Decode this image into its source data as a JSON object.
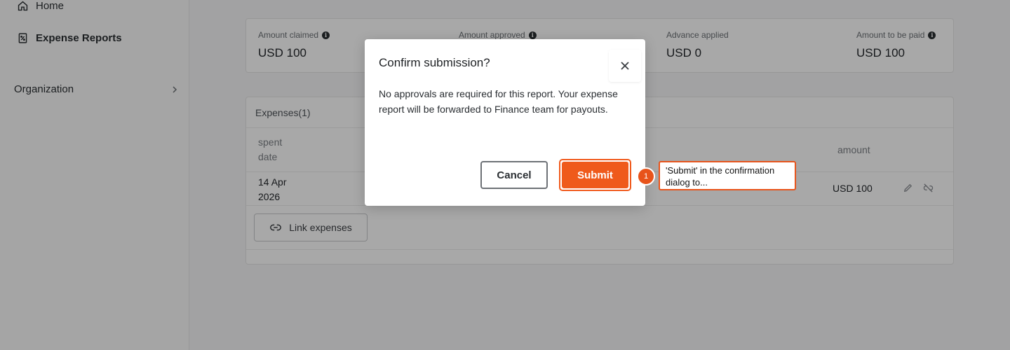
{
  "sidebar": {
    "items": [
      {
        "label": "Home",
        "icon": "home-icon"
      },
      {
        "label": "Expense Reports",
        "icon": "receipt-icon"
      }
    ],
    "organization": {
      "label": "Organization",
      "icon": "chevron-right-icon"
    }
  },
  "summary": {
    "amount_claimed": {
      "label": "Amount claimed",
      "value": "USD 100"
    },
    "amount_approved": {
      "label": "Amount approved"
    },
    "advance_applied": {
      "label": "Advance applied",
      "value": "USD 0"
    },
    "amount_to_be_paid": {
      "label": "Amount to be paid",
      "value": "USD 100"
    }
  },
  "expenses": {
    "title": "Expenses(1)",
    "columns": {
      "spent_date_line1": "spent",
      "spent_date_line2": "date",
      "amount": "amount"
    },
    "rows": [
      {
        "date_line1": "14 Apr",
        "date_line2": "2026",
        "amount": "USD 100"
      }
    ],
    "link_button": "Link expenses"
  },
  "modal": {
    "title": "Confirm submission?",
    "body": "No approvals are required for this report. Your expense report will be forwarded to Finance team for payouts.",
    "cancel": "Cancel",
    "submit": "Submit"
  },
  "annotation": {
    "step": "1",
    "text": "'Submit' in the confirmation dialog to..."
  },
  "colors": {
    "accent": "#ef5a1b",
    "overlay": "rgba(0,0,0,0.34)"
  }
}
